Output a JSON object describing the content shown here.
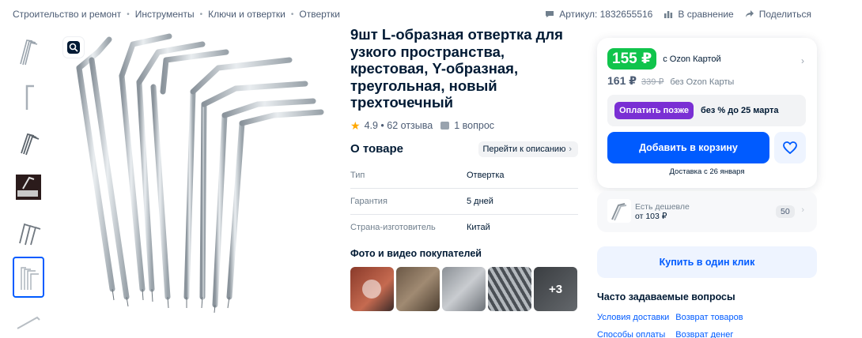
{
  "breadcrumbs": [
    "Строительство и ремонт",
    "Инструменты",
    "Ключи и отвертки",
    "Отвертки"
  ],
  "top_actions": {
    "article": "Артикул: 1832655516",
    "compare": "В сравнение",
    "share": "Поделиться"
  },
  "product": {
    "title": "9шт L-образная отвертка для узкого пространства, крестовая, Y-образная, треугольная, новый трехточечный",
    "rating": "4.9",
    "reviews": "62 отзыва",
    "questions": "1 вопрос"
  },
  "about": {
    "heading": "О товаре",
    "goto_label": "Перейти к описанию",
    "props": [
      {
        "key": "Тип",
        "value": "Отвертка"
      },
      {
        "key": "Гарантия",
        "value": "5 дней"
      },
      {
        "key": "Страна-изготовитель",
        "value": "Китай"
      }
    ]
  },
  "photos": {
    "heading": "Фото и видео покупателей",
    "more_label": "+3"
  },
  "price_card": {
    "card_price": "155 ₽",
    "card_price_label": "с Ozon Картой",
    "price": "161 ₽",
    "old_price": "339 ₽",
    "price_label": "без Ozon Карты",
    "pay_later_button": "Оплатить позже",
    "pay_later_text": "без % до 25 марта",
    "add_to_cart": "Добавить в корзину",
    "delivery": "Доставка с 26 января"
  },
  "cheaper": {
    "title": "Есть дешевле",
    "price": "от 103 ₽",
    "count": "50"
  },
  "one_click": "Купить в один клик",
  "faq": {
    "heading": "Часто задаваемые вопросы",
    "links": [
      "Условия доставки",
      "Возврат товаров",
      "Способы оплаты",
      "Возврат денег"
    ]
  },
  "colors": {
    "accent": "#005bff",
    "price_green": "#10c44c",
    "pay_later_purple": "#7a2fd4"
  },
  "icons": [
    "chat-icon",
    "compare-icon",
    "share-icon",
    "zoom-icon",
    "star-icon",
    "question-icon",
    "heart-icon",
    "chevron-right-icon"
  ]
}
